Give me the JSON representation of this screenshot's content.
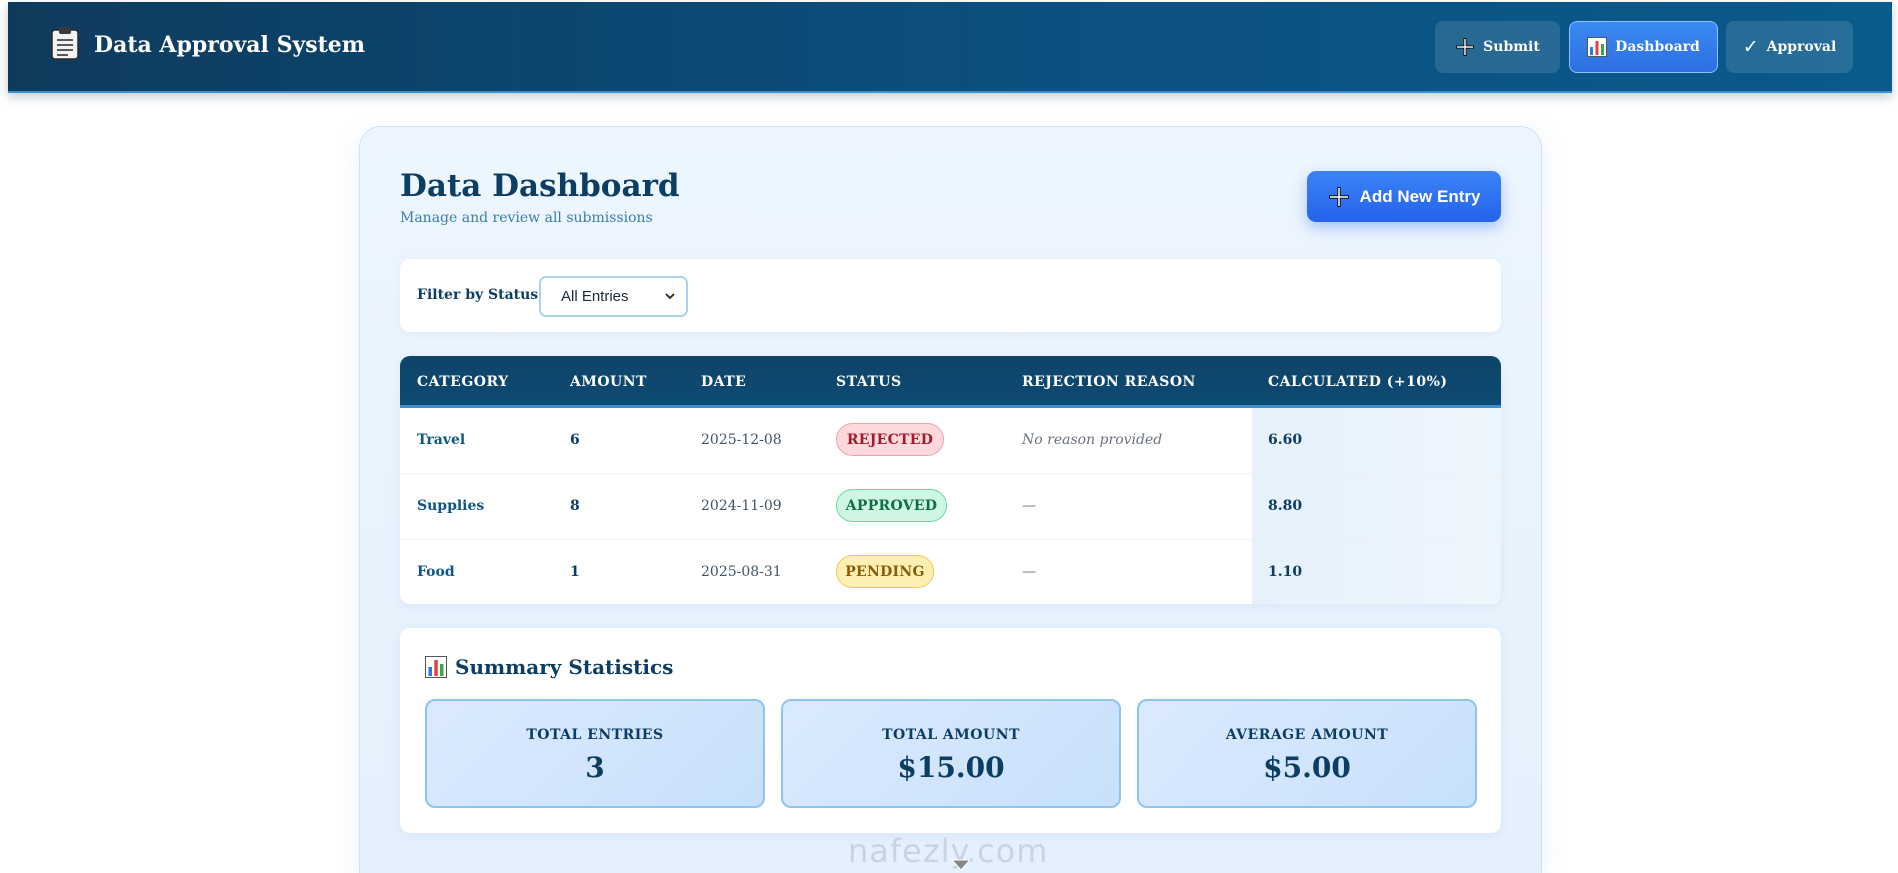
{
  "header": {
    "title": "Data Approval System",
    "logo_icon": "clipboard-icon",
    "nav": [
      {
        "label": "Submit",
        "icon": "plus-icon",
        "active": false
      },
      {
        "label": "Dashboard",
        "icon": "bar-chart-icon",
        "active": true
      },
      {
        "label": "Approval",
        "icon": "check-icon",
        "active": false
      }
    ]
  },
  "dashboard": {
    "title": "Data Dashboard",
    "subtitle": "Manage and review all submissions",
    "add_button": "Add New Entry"
  },
  "filter": {
    "label": "Filter by Status:",
    "selected": "All Entries"
  },
  "table": {
    "headers": [
      "CATEGORY",
      "AMOUNT",
      "DATE",
      "STATUS",
      "REJECTION REASON",
      "CALCULATED (+10%)"
    ],
    "rows": [
      {
        "category": "Travel",
        "amount": "6",
        "date": "2025-12-08",
        "status": "REJECTED",
        "reason": "No reason provided",
        "calculated": "6.60"
      },
      {
        "category": "Supplies",
        "amount": "8",
        "date": "2024-11-09",
        "status": "APPROVED",
        "reason": "—",
        "calculated": "8.80"
      },
      {
        "category": "Food",
        "amount": "1",
        "date": "2025-08-31",
        "status": "PENDING",
        "reason": "—",
        "calculated": "1.10"
      }
    ]
  },
  "summary": {
    "title": "Summary Statistics",
    "icon": "bar-chart-icon",
    "stats": [
      {
        "label": "TOTAL ENTRIES",
        "value": "3"
      },
      {
        "label": "TOTAL AMOUNT",
        "value": "$15.00"
      },
      {
        "label": "AVERAGE AMOUNT",
        "value": "$5.00"
      }
    ]
  },
  "watermark": "nafezly.com",
  "colors": {
    "header_bg": "#0b5080",
    "primary": "#2563eb",
    "text_dark": "#0c3d63",
    "rejected": "#a41a28",
    "approved": "#0c7043",
    "pending": "#8a5a06"
  }
}
